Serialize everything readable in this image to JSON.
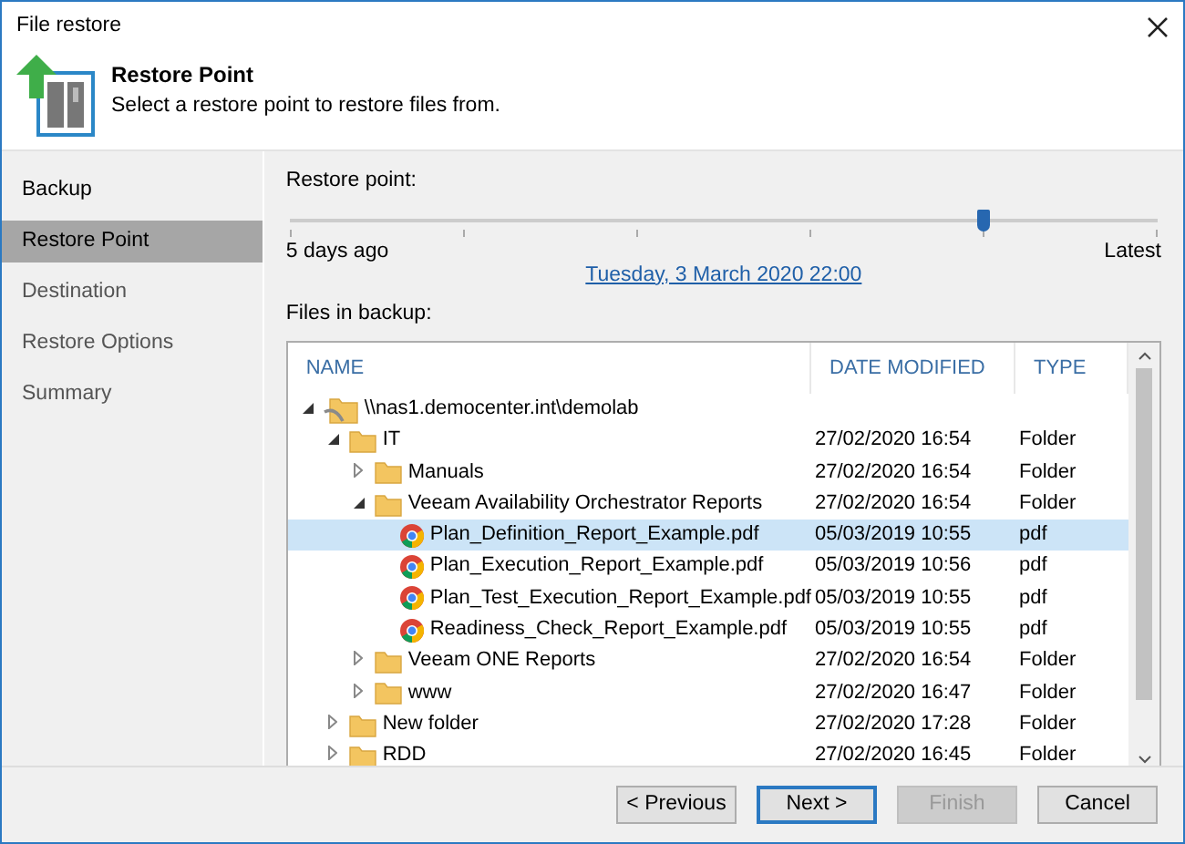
{
  "window": {
    "title": "File restore"
  },
  "header": {
    "title": "Restore Point",
    "subtitle": "Select a restore point to restore files from."
  },
  "sidebar": {
    "items": [
      {
        "label": "Backup",
        "selected": false,
        "disabled": false
      },
      {
        "label": "Restore Point",
        "selected": true,
        "disabled": false
      },
      {
        "label": "Destination",
        "selected": false,
        "disabled": true
      },
      {
        "label": "Restore Options",
        "selected": false,
        "disabled": true
      },
      {
        "label": "Summary",
        "selected": false,
        "disabled": true
      }
    ]
  },
  "restore_point": {
    "label": "Restore point:",
    "level": 0.8,
    "min_label": "5 days ago",
    "max_label": "Latest",
    "selected_date": "Tuesday, 3 March 2020 22:00"
  },
  "files": {
    "label": "Files in backup:",
    "columns": [
      "NAME",
      "DATE MODIFIED",
      "TYPE"
    ],
    "tree": [
      {
        "kind": "share",
        "name": "\\\\nas1.democenter.int\\demolab",
        "expanded": true,
        "selected": false,
        "children": [
          {
            "kind": "folder",
            "name": "IT",
            "date": "27/02/2020 16:54",
            "type": "Folder",
            "expanded": true,
            "selected": false,
            "children": [
              {
                "kind": "folder",
                "name": "Manuals",
                "date": "27/02/2020 16:54",
                "type": "Folder",
                "expanded": false,
                "selected": false
              },
              {
                "kind": "folder",
                "name": "Veeam Availability Orchestrator Reports",
                "date": "27/02/2020 16:54",
                "type": "Folder",
                "expanded": true,
                "selected": false,
                "children": [
                  {
                    "kind": "file",
                    "name": "Plan_Definition_Report_Example.pdf",
                    "date": "05/03/2019 10:55",
                    "type": "pdf",
                    "selected": true
                  },
                  {
                    "kind": "file",
                    "name": "Plan_Execution_Report_Example.pdf",
                    "date": "05/03/2019 10:56",
                    "type": "pdf",
                    "selected": false
                  },
                  {
                    "kind": "file",
                    "name": "Plan_Test_Execution_Report_Example.pdf",
                    "date": "05/03/2019 10:55",
                    "type": "pdf",
                    "selected": false
                  },
                  {
                    "kind": "file",
                    "name": "Readiness_Check_Report_Example.pdf",
                    "date": "05/03/2019 10:55",
                    "type": "pdf",
                    "selected": false
                  }
                ]
              },
              {
                "kind": "folder",
                "name": "Veeam ONE Reports",
                "date": "27/02/2020 16:54",
                "type": "Folder",
                "expanded": false,
                "selected": false
              },
              {
                "kind": "folder",
                "name": "www",
                "date": "27/02/2020 16:47",
                "type": "Folder",
                "expanded": false,
                "selected": false
              }
            ]
          },
          {
            "kind": "folder",
            "name": "New folder",
            "date": "27/02/2020 17:28",
            "type": "Folder",
            "expanded": false,
            "selected": false
          },
          {
            "kind": "folder",
            "name": "RDD",
            "date": "27/02/2020 16:45",
            "type": "Folder",
            "expanded": false,
            "selected": false
          }
        ]
      }
    ]
  },
  "buttons": [
    {
      "label": "< Previous",
      "kind": "normal",
      "disabled": false
    },
    {
      "label": "Next >",
      "kind": "default",
      "disabled": false
    },
    {
      "label": "Finish",
      "kind": "normal",
      "disabled": true
    },
    {
      "label": "Cancel",
      "kind": "normal",
      "disabled": false
    }
  ]
}
